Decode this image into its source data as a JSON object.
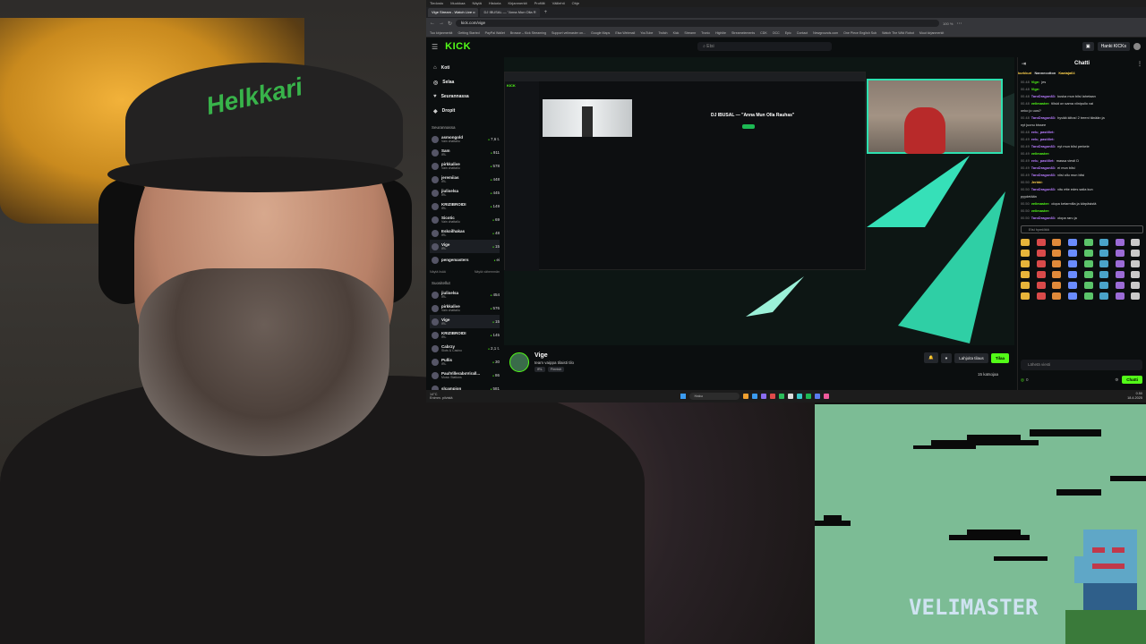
{
  "webcam": {
    "cap_text": "Helkkari"
  },
  "os": {
    "menu": [
      "Tiedosto",
      "Muokkaa",
      "Näytä",
      "Historia",
      "Kirjanmerkit",
      "Profiilit",
      "Välilehti",
      "Ohje"
    ]
  },
  "browser": {
    "tabs": [
      "Vige Stream - Watch Live o",
      "DJ IBUSAL — \"Anna Mun Olla R",
      "+"
    ],
    "url": "kick.com/vige",
    "zoom": "100 %",
    "bookmarks": [
      "Tuo kirjanmerkit",
      "Getting Started",
      "PayPal Wallet",
      "Browse – Kick Streaming",
      "Support velimaster on...",
      "Google Maps",
      "Elsa Webmail",
      "YouTube",
      "Twitch",
      "Kick",
      "Streamr",
      "Tronic",
      "Highlite",
      "Streamelements",
      "CDK",
      "OCC",
      "Epic",
      "Contact",
      "Newgrounds.com",
      "One Piece English Sub",
      "Watch The Wild Robot",
      "Muut kirjanmerkit"
    ]
  },
  "kick": {
    "logo": "KICK",
    "search_placeholder": "Etsi",
    "header_button": "Hanki KICKs",
    "nav": [
      {
        "icon": "home-icon",
        "label": "Koti"
      },
      {
        "icon": "compass-icon",
        "label": "Selaa"
      },
      {
        "icon": "heart-icon",
        "label": "Seurannassa"
      },
      {
        "icon": "drops-icon",
        "label": "Dropit"
      }
    ],
    "following_title": "Seurannassa",
    "following": [
      {
        "name": "asmongold",
        "game": "Vain chattailu",
        "count": "7,6 t."
      },
      {
        "name": "Sam",
        "game": "IRL",
        "count": "911"
      },
      {
        "name": "pirkkalive",
        "game": "Vain chattailu",
        "count": "578"
      },
      {
        "name": "jeremiias",
        "game": "IRL",
        "count": "448"
      },
      {
        "name": "jiuliselsa",
        "game": "IRL",
        "count": "445"
      },
      {
        "name": "KRIZIBROIDI",
        "game": "IRL",
        "count": "149"
      },
      {
        "name": "Sicotic",
        "game": "Vain chattailu",
        "count": "69"
      },
      {
        "name": "Eskoilhakas",
        "game": "IRL",
        "count": "48"
      },
      {
        "name": "Vige",
        "game": "IRL",
        "count": "15"
      },
      {
        "name": "pengemasters",
        "game": "",
        "count": "ei"
      }
    ],
    "show_more": "Näytä lisää",
    "show_less": "Näytä vähemmän",
    "recommended_title": "Suositellut",
    "recommended": [
      {
        "name": "jiuliselsa",
        "game": "IRL",
        "count": "454"
      },
      {
        "name": "pirkkalive",
        "game": "Vain chattailu",
        "count": "576"
      },
      {
        "name": "Vige",
        "game": "IRL",
        "count": "15"
      },
      {
        "name": "KRIZIBROIDI",
        "game": "IRL",
        "count": "145"
      },
      {
        "name": "Cabrzy",
        "game": "Slots & Casino",
        "count": "2,1 t."
      },
      {
        "name": "Pullis",
        "game": "IRL",
        "count": "30"
      },
      {
        "name": "PaulVilleraboVirall...",
        "game": "Music Stations",
        "count": "86"
      },
      {
        "name": "slcampion",
        "game": "",
        "count": "581"
      }
    ],
    "nested_title": "DJ IBUSAL — \"Anna Mun Olla Rauhas\"",
    "stream": {
      "name": "Vige",
      "title": "team vaippa tilaisti tilo",
      "tags": [
        "IRL",
        "Finnish"
      ],
      "subscribe": "Lahjoita tilaus",
      "follow": "Tilaa",
      "viewers": "15 katsojaa"
    },
    "chat": {
      "title": "Chatti",
      "top_users": [
        "kurkkuri",
        "Nannecotton",
        "Kaataja64"
      ],
      "messages": [
        {
          "time": "00.48",
          "user": "Vige:",
          "color": "#53fc18",
          "text": "jes"
        },
        {
          "time": "00.48",
          "user": "Vige:",
          "color": "#53fc18",
          "text": ""
        },
        {
          "time": "00.48",
          "user": "TaroDragon83:",
          "color": "#b97cff",
          "text": "kuska mun bilsi lahetaan"
        },
        {
          "time": "00.48",
          "user": "velimaster:",
          "color": "#53fc18",
          "text": "tilisid on sama viinipullo vai"
        },
        {
          "time": "",
          "user": "",
          "color": "#ddd",
          "text": "onko jo uusi?"
        },
        {
          "time": "00.48",
          "user": "TaroDragon83:",
          "color": "#b97cff",
          "text": "hyvää kiitos! 2 treeni tänään ja"
        },
        {
          "time": "",
          "user": "",
          "color": "#ddd",
          "text": "nyt juonu bissee"
        },
        {
          "time": "00.48",
          "user": "eelu_pastillet:",
          "color": "#b97cff",
          "text": ""
        },
        {
          "time": "00.49",
          "user": "eelu_pastillet:",
          "color": "#b97cff",
          "text": ""
        },
        {
          "time": "00.49",
          "user": "TaroDragon83:",
          "color": "#b97cff",
          "text": "nyt mun bilsi perkele"
        },
        {
          "time": "00.49",
          "user": "velimaster:",
          "color": "#53fc18",
          "text": ""
        },
        {
          "time": "00.49",
          "user": "eelu_pastillet:",
          "color": "#b97cff",
          "text": "massa viesti D"
        },
        {
          "time": "00.49",
          "user": "TaroDragon83:",
          "color": "#b97cff",
          "text": "ei mun bilsi"
        },
        {
          "time": "00.49",
          "user": "TaroDragon83:",
          "color": "#b97cff",
          "text": "viisi ollu mun bilsi"
        },
        {
          "time": "00.50",
          "user": "Jerbbi:",
          "color": "#ffd24d",
          "text": ""
        },
        {
          "time": "00.50",
          "user": "TaroDragon83:",
          "color": "#b97cff",
          "text": "vitu ette edes saiia kun"
        },
        {
          "time": "",
          "user": "",
          "color": "#ddd",
          "text": "pyydetään"
        },
        {
          "time": "00.50",
          "user": "velimaster:",
          "color": "#53fc18",
          "text": "olopa ketarmilla ja kärpäsistä"
        },
        {
          "time": "00.50",
          "user": "velimaster:",
          "color": "#53fc18",
          "text": ""
        },
        {
          "time": "00.50",
          "user": "TaroDragon83:",
          "color": "#b97cff",
          "text": "olopa raru ja"
        }
      ],
      "emote_search_placeholder": "Etsi hymiöitä",
      "input_placeholder": "Lähetä viesti",
      "points": "0",
      "send": "Chatti"
    }
  },
  "taskbar": {
    "weather_temp": "14°C",
    "weather_desc": "Enimm. pilvistä",
    "search": "Haku",
    "time": "0.50",
    "date": "18.4.2025"
  },
  "retro": {
    "title": "VELIMASTER"
  },
  "colors": {
    "kick_green": "#53fc18",
    "overlay_teal": "#2de0b0",
    "retro_bg": "#7cbc95"
  }
}
